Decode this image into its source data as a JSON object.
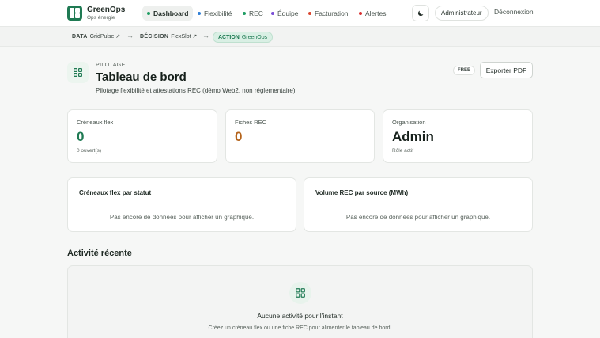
{
  "brand": {
    "name": "GreenOps",
    "subtitle": "Ops énergie"
  },
  "nav": {
    "items": [
      {
        "label": "Dashboard",
        "dot": "#1f9d63"
      },
      {
        "label": "Flexibilité",
        "dot": "#2f7fd6"
      },
      {
        "label": "REC",
        "dot": "#1f9d63"
      },
      {
        "label": "Équipe",
        "dot": "#7b4fd6"
      },
      {
        "label": "Facturation",
        "dot": "#d9462f"
      },
      {
        "label": "Alertes",
        "dot": "#d93030"
      }
    ],
    "theme_icon": "moon-icon",
    "role_label": "Administrateur",
    "logout_label": "Déconnexion"
  },
  "breadcrumb": {
    "items": [
      {
        "tag": "DATA",
        "label": "GridPulse ↗"
      },
      {
        "tag": "DÉCISION",
        "label": "FlexSlot ↗"
      }
    ],
    "separator": "→",
    "action": {
      "tag": "ACTION",
      "label": "GreenOps"
    }
  },
  "header": {
    "eyebrow": "PILOTAGE",
    "title": "Tableau de bord",
    "subtitle": "Pilotage flexibilité et attestations REC (démo Web2, non réglementaire).",
    "badge": "FREE",
    "export_label": "Exporter PDF",
    "icon": "grid-icon"
  },
  "kpis": [
    {
      "label": "Créneaux flex",
      "value": "0",
      "note": "0 ouvert(s)",
      "color": "#1f7a53"
    },
    {
      "label": "Fiches REC",
      "value": "0",
      "note": "",
      "color": "#b4631b"
    },
    {
      "label": "Organisation",
      "value": "Admin",
      "note": "Rôle actif",
      "color": "#16201b"
    }
  ],
  "charts": [
    {
      "title": "Créneaux flex par statut",
      "empty": "Pas encore de données pour afficher un graphique."
    },
    {
      "title": "Volume REC par source (MWh)",
      "empty": "Pas encore de données pour afficher un graphique."
    }
  ],
  "activity": {
    "section_title": "Activité récente",
    "empty_title": "Aucune activité pour l’instant",
    "empty_sub": "Créez un créneau flex ou une fiche REC pour alimenter le tableau de bord.",
    "icon": "grid-icon"
  }
}
